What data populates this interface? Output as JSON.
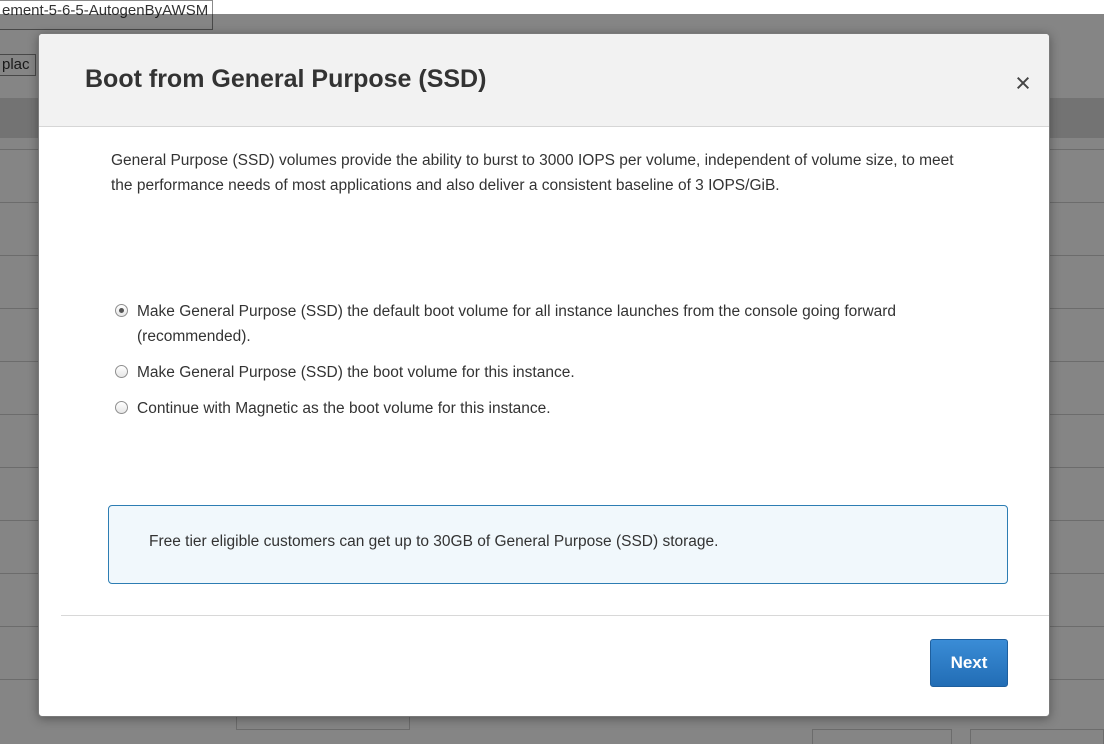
{
  "background": {
    "top_field_text": "ement-5-6-5-AutogenByAWSM",
    "left_field_text": "plac"
  },
  "modal": {
    "title": "Boot from General Purpose (SSD)",
    "close_symbol": "×",
    "intro": "General Purpose (SSD) volumes provide the ability to burst to 3000 IOPS per volume, independent of volume size, to meet the performance needs of most applications and also deliver a consistent baseline of 3 IOPS/GiB.",
    "options": [
      {
        "label": "Make General Purpose (SSD) the default boot volume for all instance launches from the console going forward (recommended).",
        "selected": true
      },
      {
        "label": "Make General Purpose (SSD) the boot volume for this instance.",
        "selected": false
      },
      {
        "label": "Continue with Magnetic as the boot volume for this instance.",
        "selected": false
      }
    ],
    "info": "Free tier eligible customers can get up to 30GB of General Purpose (SSD) storage.",
    "next_label": "Next"
  },
  "colors": {
    "primary_button": "#226db5",
    "info_border": "#2d7db3",
    "info_background": "#f1f8fc"
  }
}
